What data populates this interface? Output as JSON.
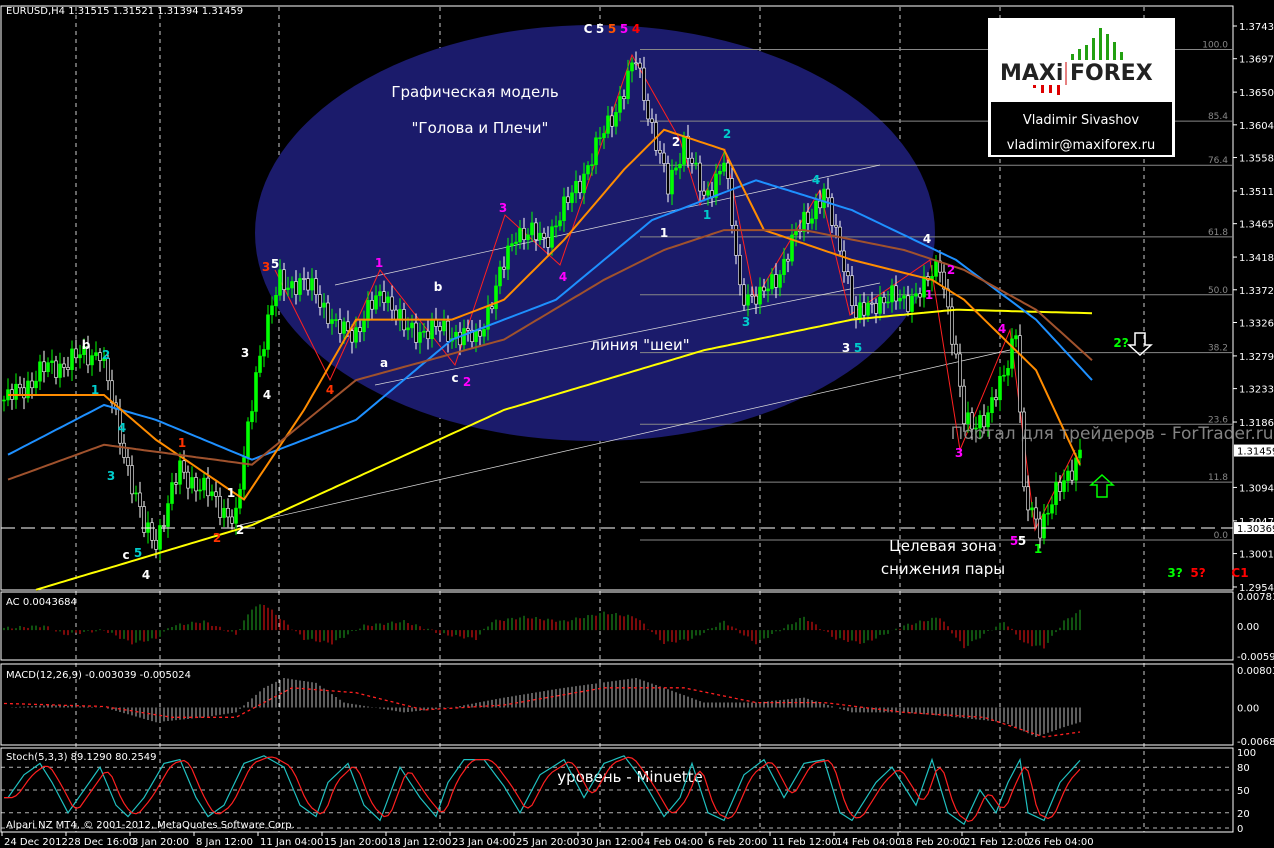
{
  "header": {
    "symbol_info": "EURUSD,H4  1.31515 1.31521 1.31394 1.31459"
  },
  "footer": {
    "copyright": "Alpari NZ MT4, © 2001-2012, MetaQuotes Software Corp."
  },
  "logo": {
    "brand_left": "MAXi",
    "brand_right": "FOREX",
    "author": "Vladimir Sivashov",
    "email": "vladimir@maxiforex.ru"
  },
  "annotations": {
    "pattern_title": "Графическая модель",
    "pattern_name": "\"Голова и Плечи\"",
    "neckline": "линия \"шеи\"",
    "target_1": "Целевая зона",
    "target_2": "снижения пары",
    "watermark": "Портал для трейдеров - ForTrader.ru",
    "level": "уровень - Minuette"
  },
  "colors": {
    "bull": "#00ff00",
    "bear": "#ffffff",
    "ellipse": "#1b1b6b",
    "ma_yellow": "#ffff00",
    "ma_blue": "#1e90ff",
    "ma_orange": "#ff8c00",
    "ma_brown": "#a0522d"
  },
  "wave_labels": [
    {
      "t": "b",
      "c": "#ffffff"
    },
    {
      "t": "2",
      "c": "#00cccc"
    },
    {
      "t": "1",
      "c": "#00cccc"
    },
    {
      "t": "4",
      "c": "#00cccc"
    },
    {
      "t": "3",
      "c": "#00cccc"
    },
    {
      "t": "c",
      "c": "#ffffff"
    },
    {
      "t": "5",
      "c": "#00cccc"
    },
    {
      "t": "4",
      "c": "#ffffff"
    },
    {
      "t": "1",
      "c": "#ff3300"
    },
    {
      "t": "2",
      "c": "#ff3300"
    },
    {
      "t": "1",
      "c": "#ffffff"
    },
    {
      "t": "2",
      "c": "#ffffff"
    },
    {
      "t": "3",
      "c": "#ffffff"
    },
    {
      "t": "4",
      "c": "#ffffff"
    },
    {
      "t": "3",
      "c": "#ff3300"
    },
    {
      "t": "5",
      "c": "#ffffff"
    },
    {
      "t": "4",
      "c": "#ff3300"
    },
    {
      "t": "1",
      "c": "#ff00ff"
    },
    {
      "t": "b",
      "c": "#ffffff"
    },
    {
      "t": "a",
      "c": "#ffffff"
    },
    {
      "t": "c",
      "c": "#ffffff"
    },
    {
      "t": "2",
      "c": "#ff00ff"
    },
    {
      "t": "3",
      "c": "#ff00ff"
    },
    {
      "t": "4",
      "c": "#ff00ff"
    },
    {
      "t": "2",
      "c": "#ffffff"
    },
    {
      "t": "2",
      "c": "#00cccc"
    },
    {
      "t": "1",
      "c": "#00cccc"
    },
    {
      "t": "1",
      "c": "#ffffff"
    },
    {
      "t": "3",
      "c": "#00cccc"
    },
    {
      "t": "4",
      "c": "#00cccc"
    },
    {
      "t": "3",
      "c": "#ffffff"
    },
    {
      "t": "5",
      "c": "#00cccc"
    },
    {
      "t": "4",
      "c": "#ffffff"
    },
    {
      "t": "2",
      "c": "#ff00ff"
    },
    {
      "t": "1",
      "c": "#ff00ff"
    },
    {
      "t": "3",
      "c": "#ff00ff"
    },
    {
      "t": "4",
      "c": "#ff00ff"
    },
    {
      "t": "5",
      "c": "#ff00ff"
    },
    {
      "t": "5",
      "c": "#ffffff"
    },
    {
      "t": "1",
      "c": "#00ff00"
    },
    {
      "t": "2?",
      "c": "#00ff00"
    },
    {
      "t": "3?",
      "c": "#00ff00"
    },
    {
      "t": "5?",
      "c": "#ff0000"
    },
    {
      "t": "C1",
      "c": "#ff0000"
    },
    {
      "t": "C",
      "c": "#ffffff"
    },
    {
      "t": "5",
      "c": "#ffffff"
    },
    {
      "t": "5",
      "c": "#ff5500"
    },
    {
      "t": "5",
      "c": "#ff00ff"
    },
    {
      "t": "4",
      "c": "#ff0000"
    }
  ],
  "chart_data": {
    "type": "candlestick",
    "title": "EURUSD,H4",
    "ohlc_last": {
      "open": 1.31515,
      "high": 1.31521,
      "low": 1.31394,
      "close": 1.31459
    },
    "ylim": [
      1.2932,
      1.3762
    ],
    "y_ticks": [
      "1.37430",
      "1.36970",
      "1.36500",
      "1.36040",
      "1.35580",
      "1.35110",
      "1.34650",
      "1.34180",
      "1.33720",
      "1.33260",
      "1.32790",
      "1.32330",
      "1.31860",
      "1.30940",
      "1.30470",
      "1.30010",
      "1.29540"
    ],
    "current_price": "1.31459",
    "dashed_level": "1.30369",
    "x_ticks": [
      "24 Dec 2012",
      "28 Dec 16:00",
      "3 Jan 20:00",
      "8 Jan 12:00",
      "11 Jan 04:00",
      "15 Jan 20:00",
      "18 Jan 12:00",
      "23 Jan 04:00",
      "25 Jan 20:00",
      "30 Jan 12:00",
      "4 Feb 04:00",
      "6 Feb 20:00",
      "11 Feb 12:00",
      "14 Feb 04:00",
      "18 Feb 20:00",
      "21 Feb 12:00",
      "26 Feb 04:00"
    ],
    "fib": {
      "low": 1.302,
      "high": 1.371,
      "levels": [
        "0.0",
        "11.8",
        "23.6",
        "38.2",
        "50.0",
        "61.8",
        "76.4",
        "85.4",
        "100.0"
      ]
    },
    "price_path": [
      [
        1,
        1.3217
      ],
      [
        10,
        1.3259
      ],
      [
        24,
        1.3287
      ],
      [
        28,
        1.3189
      ],
      [
        35,
        1.3034
      ],
      [
        38,
        1.302
      ],
      [
        44,
        1.3119
      ],
      [
        50,
        1.309
      ],
      [
        58,
        1.3048
      ],
      [
        63,
        1.3259
      ],
      [
        69,
        1.3386
      ],
      [
        78,
        1.3372
      ],
      [
        83,
        1.3315
      ],
      [
        88,
        1.3315
      ],
      [
        95,
        1.3372
      ],
      [
        100,
        1.3315
      ],
      [
        110,
        1.3315
      ],
      [
        118,
        1.3301
      ],
      [
        123,
        1.3372
      ],
      [
        128,
        1.3456
      ],
      [
        135,
        1.3442
      ],
      [
        140,
        1.3484
      ],
      [
        148,
        1.3569
      ],
      [
        155,
        1.3653
      ],
      [
        158,
        1.3695
      ],
      [
        161,
        1.3625
      ],
      [
        166,
        1.3512
      ],
      [
        170,
        1.3583
      ],
      [
        175,
        1.3498
      ],
      [
        180,
        1.3555
      ],
      [
        184,
        1.3372
      ],
      [
        189,
        1.3358
      ],
      [
        194,
        1.34
      ],
      [
        200,
        1.347
      ],
      [
        205,
        1.3505
      ],
      [
        210,
        1.3414
      ],
      [
        213,
        1.333
      ],
      [
        218,
        1.3358
      ],
      [
        225,
        1.3358
      ],
      [
        230,
        1.3372
      ],
      [
        234,
        1.3414
      ],
      [
        236,
        1.3344
      ],
      [
        240,
        1.3189
      ],
      [
        246,
        1.3189
      ],
      [
        250,
        1.3259
      ],
      [
        253,
        1.3315
      ],
      [
        255,
        1.3077
      ],
      [
        259,
        1.3042
      ],
      [
        264,
        1.3091
      ],
      [
        269,
        1.3146
      ]
    ],
    "series": [
      {
        "name": "MA yellow",
        "color": "#ffff00",
        "points": [
          [
            8,
            1.295
          ],
          [
            62,
            1.3041
          ],
          [
            125,
            1.3203
          ],
          [
            175,
            1.3287
          ],
          [
            212,
            1.333
          ],
          [
            238,
            1.3344
          ],
          [
            272,
            1.3339
          ]
        ]
      },
      {
        "name": "MA blue",
        "color": "#1e90ff",
        "points": [
          [
            1,
            1.314
          ],
          [
            25,
            1.321
          ],
          [
            38,
            1.3189
          ],
          [
            62,
            1.3133
          ],
          [
            88,
            1.3189
          ],
          [
            112,
            1.3302
          ],
          [
            138,
            1.3358
          ],
          [
            162,
            1.347
          ],
          [
            188,
            1.3526
          ],
          [
            212,
            1.3484
          ],
          [
            238,
            1.3414
          ],
          [
            258,
            1.333
          ],
          [
            272,
            1.3245
          ]
        ]
      },
      {
        "name": "MA orange",
        "color": "#ff8c00",
        "points": [
          [
            1,
            1.3224
          ],
          [
            25,
            1.3224
          ],
          [
            38,
            1.3161
          ],
          [
            60,
            1.3077
          ],
          [
            75,
            1.3203
          ],
          [
            88,
            1.333
          ],
          [
            112,
            1.333
          ],
          [
            125,
            1.3358
          ],
          [
            140,
            1.3442
          ],
          [
            155,
            1.3541
          ],
          [
            165,
            1.3597
          ],
          [
            180,
            1.3569
          ],
          [
            190,
            1.3456
          ],
          [
            212,
            1.3414
          ],
          [
            232,
            1.3386
          ],
          [
            240,
            1.3358
          ],
          [
            258,
            1.3259
          ],
          [
            269,
            1.3126
          ]
        ]
      },
      {
        "name": "MA brown",
        "color": "#a0522d",
        "points": [
          [
            1,
            1.3105
          ],
          [
            25,
            1.3154
          ],
          [
            62,
            1.3126
          ],
          [
            88,
            1.3245
          ],
          [
            125,
            1.3302
          ],
          [
            150,
            1.3386
          ],
          [
            165,
            1.3428
          ],
          [
            180,
            1.3456
          ],
          [
            200,
            1.3456
          ],
          [
            225,
            1.3428
          ],
          [
            240,
            1.34
          ],
          [
            258,
            1.3344
          ],
          [
            272,
            1.3273
          ]
        ]
      }
    ],
    "ac": {
      "label": "AC 0.0043684",
      "ticks": [
        "0.007811",
        "0.00",
        "-0.00593"
      ],
      "ylim": [
        -0.00593,
        0.007811
      ],
      "points": [
        [
          1,
          0.0005
        ],
        [
          10,
          0.001
        ],
        [
          15,
          -0.001
        ],
        [
          25,
          0
        ],
        [
          32,
          -0.003
        ],
        [
          38,
          -0.002
        ],
        [
          42,
          0.001
        ],
        [
          50,
          0.002
        ],
        [
          58,
          -0.001
        ],
        [
          62,
          0.005
        ],
        [
          65,
          0.006
        ],
        [
          70,
          0.002
        ],
        [
          75,
          -0.002
        ],
        [
          82,
          -0.003
        ],
        [
          90,
          0.001
        ],
        [
          100,
          0.002
        ],
        [
          110,
          -0.001
        ],
        [
          118,
          -0.002
        ],
        [
          122,
          0.002
        ],
        [
          130,
          0.003
        ],
        [
          140,
          0.002
        ],
        [
          150,
          0.004
        ],
        [
          158,
          0.003
        ],
        [
          165,
          -0.003
        ],
        [
          172,
          -0.002
        ],
        [
          180,
          0.002
        ],
        [
          188,
          -0.003
        ],
        [
          200,
          0.003
        ],
        [
          208,
          -0.002
        ],
        [
          215,
          -0.003
        ],
        [
          225,
          0.001
        ],
        [
          234,
          0.003
        ],
        [
          240,
          -0.004
        ],
        [
          250,
          0.002
        ],
        [
          255,
          -0.003
        ],
        [
          260,
          -0.004
        ],
        [
          265,
          0.002
        ],
        [
          269,
          0.0044
        ]
      ]
    },
    "macd": {
      "label": "MACD(12,26,9) -0.003039 -0.005024",
      "ticks": [
        "0.008031",
        "0.00",
        "-0.006821"
      ],
      "ylim": [
        -0.006821,
        0.008031
      ],
      "hist": [
        [
          1,
          0
        ],
        [
          12,
          0.0005
        ],
        [
          25,
          0
        ],
        [
          38,
          -0.003
        ],
        [
          50,
          -0.002
        ],
        [
          58,
          -0.001
        ],
        [
          65,
          0.004
        ],
        [
          70,
          0.006
        ],
        [
          78,
          0.005
        ],
        [
          85,
          0.001
        ],
        [
          100,
          -0.001
        ],
        [
          112,
          0
        ],
        [
          125,
          0.002
        ],
        [
          140,
          0.004
        ],
        [
          158,
          0.006
        ],
        [
          165,
          0.004
        ],
        [
          175,
          0.001
        ],
        [
          188,
          0.001
        ],
        [
          200,
          0.002
        ],
        [
          212,
          -0.001
        ],
        [
          225,
          -0.001
        ],
        [
          238,
          -0.002
        ],
        [
          250,
          -0.003
        ],
        [
          258,
          -0.006
        ],
        [
          265,
          -0.004
        ],
        [
          269,
          -0.003
        ]
      ],
      "signal": [
        [
          1,
          0.0008
        ],
        [
          25,
          0.0002
        ],
        [
          42,
          -0.002
        ],
        [
          58,
          -0.002
        ],
        [
          72,
          0.004
        ],
        [
          88,
          0.003
        ],
        [
          105,
          -0.0005
        ],
        [
          125,
          0.0005
        ],
        [
          150,
          0.004
        ],
        [
          170,
          0.004
        ],
        [
          188,
          0.001
        ],
        [
          205,
          0.001
        ],
        [
          225,
          -0.001
        ],
        [
          245,
          -0.002
        ],
        [
          260,
          -0.006
        ],
        [
          269,
          -0.005
        ]
      ]
    },
    "stoch": {
      "label": "Stoch(5,3,3) 89.1290 80.2549",
      "ticks": [
        "100",
        "80",
        "50",
        "20",
        "0"
      ],
      "ylim": [
        0,
        100
      ],
      "main": [
        [
          1,
          40
        ],
        [
          5,
          70
        ],
        [
          9,
          85
        ],
        [
          12,
          60
        ],
        [
          16,
          20
        ],
        [
          20,
          50
        ],
        [
          24,
          80
        ],
        [
          28,
          30
        ],
        [
          31,
          15
        ],
        [
          35,
          40
        ],
        [
          40,
          85
        ],
        [
          44,
          90
        ],
        [
          48,
          40
        ],
        [
          51,
          15
        ],
        [
          55,
          30
        ],
        [
          60,
          85
        ],
        [
          65,
          95
        ],
        [
          70,
          80
        ],
        [
          74,
          30
        ],
        [
          78,
          15
        ],
        [
          81,
          60
        ],
        [
          86,
          85
        ],
        [
          90,
          30
        ],
        [
          94,
          10
        ],
        [
          99,
          80
        ],
        [
          104,
          40
        ],
        [
          108,
          15
        ],
        [
          111,
          60
        ],
        [
          115,
          90
        ],
        [
          120,
          90
        ],
        [
          125,
          55
        ],
        [
          129,
          20
        ],
        [
          134,
          70
        ],
        [
          140,
          90
        ],
        [
          145,
          40
        ],
        [
          150,
          85
        ],
        [
          155,
          95
        ],
        [
          160,
          60
        ],
        [
          165,
          15
        ],
        [
          169,
          40
        ],
        [
          172,
          85
        ],
        [
          176,
          20
        ],
        [
          180,
          10
        ],
        [
          185,
          70
        ],
        [
          190,
          90
        ],
        [
          195,
          40
        ],
        [
          200,
          85
        ],
        [
          205,
          90
        ],
        [
          209,
          20
        ],
        [
          212,
          10
        ],
        [
          218,
          60
        ],
        [
          222,
          80
        ],
        [
          228,
          30
        ],
        [
          232,
          90
        ],
        [
          236,
          20
        ],
        [
          240,
          5
        ],
        [
          244,
          50
        ],
        [
          248,
          20
        ],
        [
          251,
          60
        ],
        [
          254,
          90
        ],
        [
          256,
          20
        ],
        [
          260,
          10
        ],
        [
          264,
          60
        ],
        [
          269,
          89
        ]
      ]
    }
  }
}
